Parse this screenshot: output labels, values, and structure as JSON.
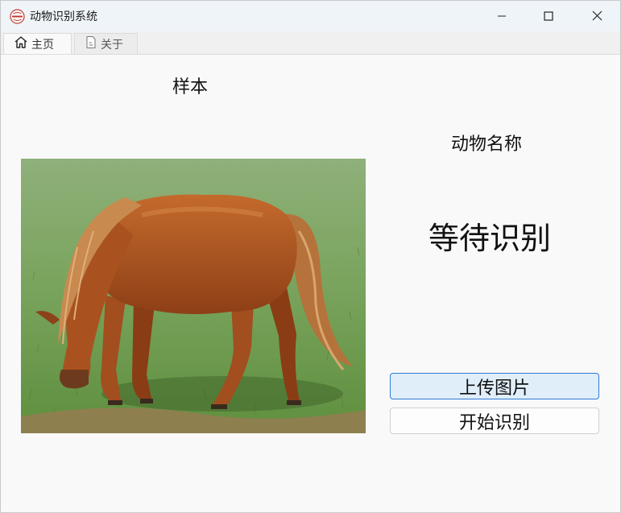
{
  "window": {
    "title": "动物识别系统",
    "icon": "app-logo-icon",
    "controls": [
      "minimize-icon",
      "maximize-icon",
      "close-icon"
    ]
  },
  "tabs": [
    {
      "label": "主页",
      "icon": "home-icon",
      "active": true
    },
    {
      "label": "关于",
      "icon": "document-icon",
      "active": false
    }
  ],
  "main": {
    "sample_label": "样本",
    "name_label": "动物名称",
    "result_text": "等待识别",
    "sample_image_subject": "horse grazing on grass",
    "upload_button": "上传图片",
    "start_button": "开始识别"
  },
  "colors": {
    "accent": "#2f7bd8",
    "primary_button_bg": "#e0eefa",
    "background": "#f9f9f9"
  }
}
